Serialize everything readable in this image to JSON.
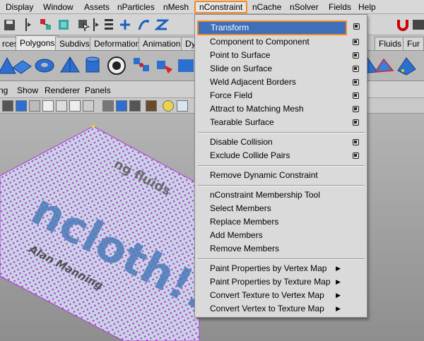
{
  "menubar": {
    "display": "Display",
    "window": "Window",
    "assets": "Assets",
    "nparticles": "nParticles",
    "nmesh": "nMesh",
    "nconstraint": "nConstraint",
    "ncache": "nCache",
    "nsolver": "nSolver",
    "fields": "Fields",
    "help": "Help"
  },
  "shelf_tabs": {
    "surfaces": "rces",
    "polygons": "Polygons",
    "subdivs": "Subdivs",
    "deformation": "Deformation",
    "animation": "Animation",
    "dynamics": "Dy",
    "fluids": "Fluids",
    "fur": "Fur",
    "active": "Polygons"
  },
  "panel_menu": {
    "lighting": "ng",
    "show": "Show",
    "renderer": "Renderer",
    "panels": "Panels"
  },
  "viewport": {
    "cloth_text": "ncloth!!",
    "subtitle_text": "ng fluids",
    "author_text": "Alan Manning"
  },
  "dropdown": {
    "items": {
      "transform": "Transform",
      "component_to_component": "Component to Component",
      "point_to_surface": "Point to Surface",
      "slide_on_surface": "Slide on Surface",
      "weld_adjacent_borders": "Weld Adjacent Borders",
      "force_field": "Force Field",
      "attract_to_matching_mesh": "Attract to Matching Mesh",
      "tearable_surface": "Tearable Surface",
      "disable_collision": "Disable Collision",
      "exclude_collide_pairs": "Exclude Collide Pairs",
      "remove_dynamic_constraint": "Remove Dynamic Constraint",
      "membership_tool": "nConstraint Membership Tool",
      "select_members": "Select Members",
      "replace_members": "Replace Members",
      "add_members": "Add Members",
      "remove_members": "Remove Members",
      "paint_by_vertex_map": "Paint Properties by Vertex Map",
      "paint_by_texture_map": "Paint Properties by Texture Map",
      "convert_texture_to_vertex": "Convert Texture to Vertex Map",
      "convert_vertex_to_texture": "Convert Vertex to Texture Map"
    },
    "highlighted": "Transform"
  },
  "colors": {
    "highlight_bg": "#3e6fb8",
    "highlight_border": "#f08a24",
    "menu_bg": "#dadada",
    "cloth_fill": "#c9d4e4",
    "vertex_color": "#b33ad6"
  },
  "icons": {
    "option_box": "option-box-icon",
    "submenu_arrow": "submenu-arrow-icon"
  }
}
